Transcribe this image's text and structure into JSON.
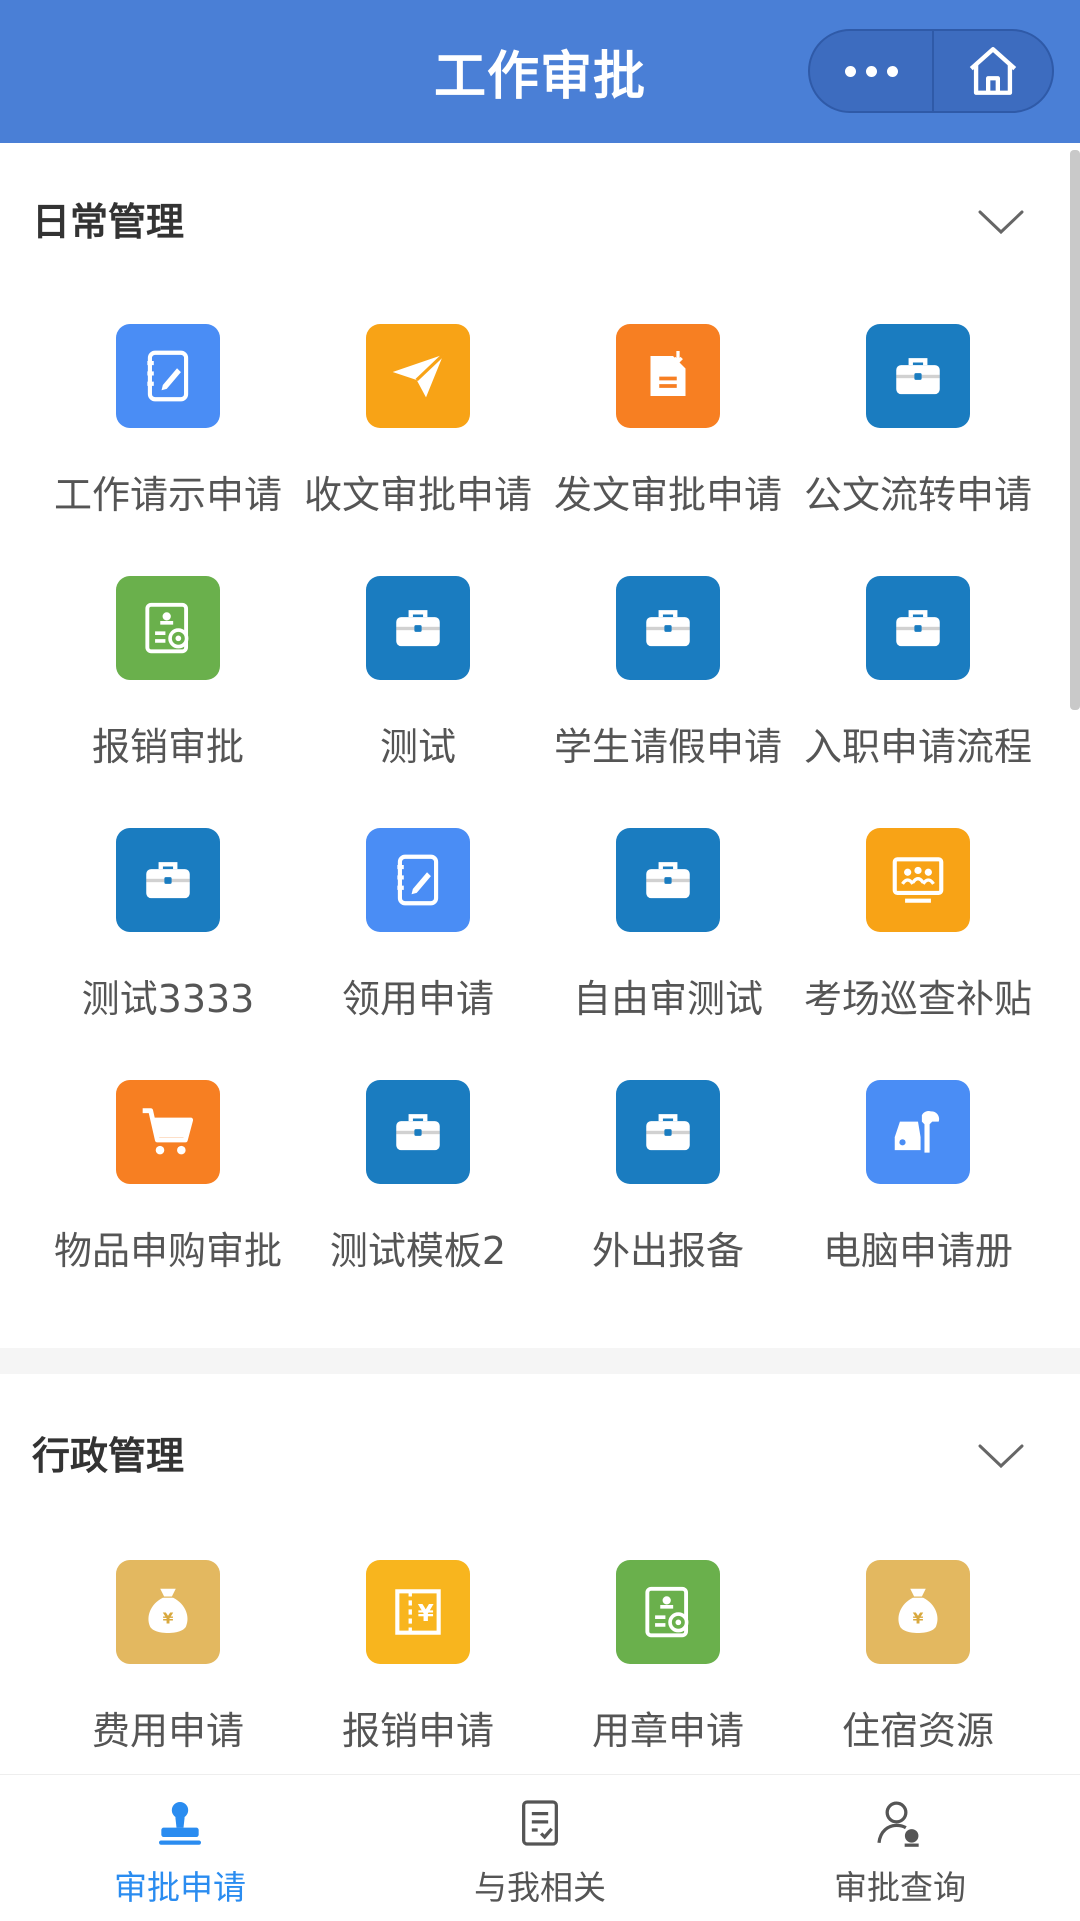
{
  "header": {
    "title": "工作审批",
    "bg_color": "#4a7fd6"
  },
  "sections": [
    {
      "title": "日常管理",
      "items": [
        {
          "label": "工作请示申请",
          "icon": "notebook-pen-icon",
          "color": "#4a8df5"
        },
        {
          "label": "收文审批申请",
          "icon": "paper-plane-icon",
          "color": "#f8a316"
        },
        {
          "label": "发文审批申请",
          "icon": "document-download-icon",
          "color": "#f77f22"
        },
        {
          "label": "公文流转申请",
          "icon": "briefcase-icon",
          "color": "#1a7cc0"
        },
        {
          "label": "报销审批",
          "icon": "certificate-icon",
          "color": "#6ab04c"
        },
        {
          "label": "测试",
          "icon": "briefcase-icon",
          "color": "#1a7cc0"
        },
        {
          "label": "学生请假申请",
          "icon": "briefcase-icon",
          "color": "#1a7cc0"
        },
        {
          "label": "入职申请流程",
          "icon": "briefcase-icon",
          "color": "#1a7cc0"
        },
        {
          "label": "测试3333",
          "icon": "briefcase-icon",
          "color": "#1a7cc0"
        },
        {
          "label": "领用申请",
          "icon": "notebook-pen-icon",
          "color": "#4a8df5"
        },
        {
          "label": "自由审测试",
          "icon": "briefcase-icon",
          "color": "#1a7cc0"
        },
        {
          "label": "考场巡查补贴",
          "icon": "monitor-people-icon",
          "color": "#f8a316"
        },
        {
          "label": "物品申购审批",
          "icon": "shopping-cart-icon",
          "color": "#f77f22"
        },
        {
          "label": "测试模板2",
          "icon": "briefcase-icon",
          "color": "#1a7cc0"
        },
        {
          "label": "外出报备",
          "icon": "briefcase-icon",
          "color": "#1a7cc0"
        },
        {
          "label": "电脑申请册",
          "icon": "car-wrench-icon",
          "color": "#4a8df5"
        }
      ]
    },
    {
      "title": "行政管理",
      "items": [
        {
          "label": "费用申请",
          "icon": "money-bag-icon",
          "color": "#e3b860"
        },
        {
          "label": "报销申请",
          "icon": "receipt-yen-icon",
          "color": "#f8b51e"
        },
        {
          "label": "用章申请",
          "icon": "certificate-icon",
          "color": "#6ab04c"
        },
        {
          "label": "住宿资源",
          "icon": "money-bag-icon",
          "color": "#e3b860"
        }
      ]
    }
  ],
  "tabbar": {
    "active_color": "#2a8cf0",
    "inactive_color": "#555555",
    "tabs": [
      {
        "label": "审批申请",
        "icon": "stamp-icon",
        "active": true
      },
      {
        "label": "与我相关",
        "icon": "document-check-icon",
        "active": false
      },
      {
        "label": "审批查询",
        "icon": "user-search-icon",
        "active": false
      }
    ]
  }
}
